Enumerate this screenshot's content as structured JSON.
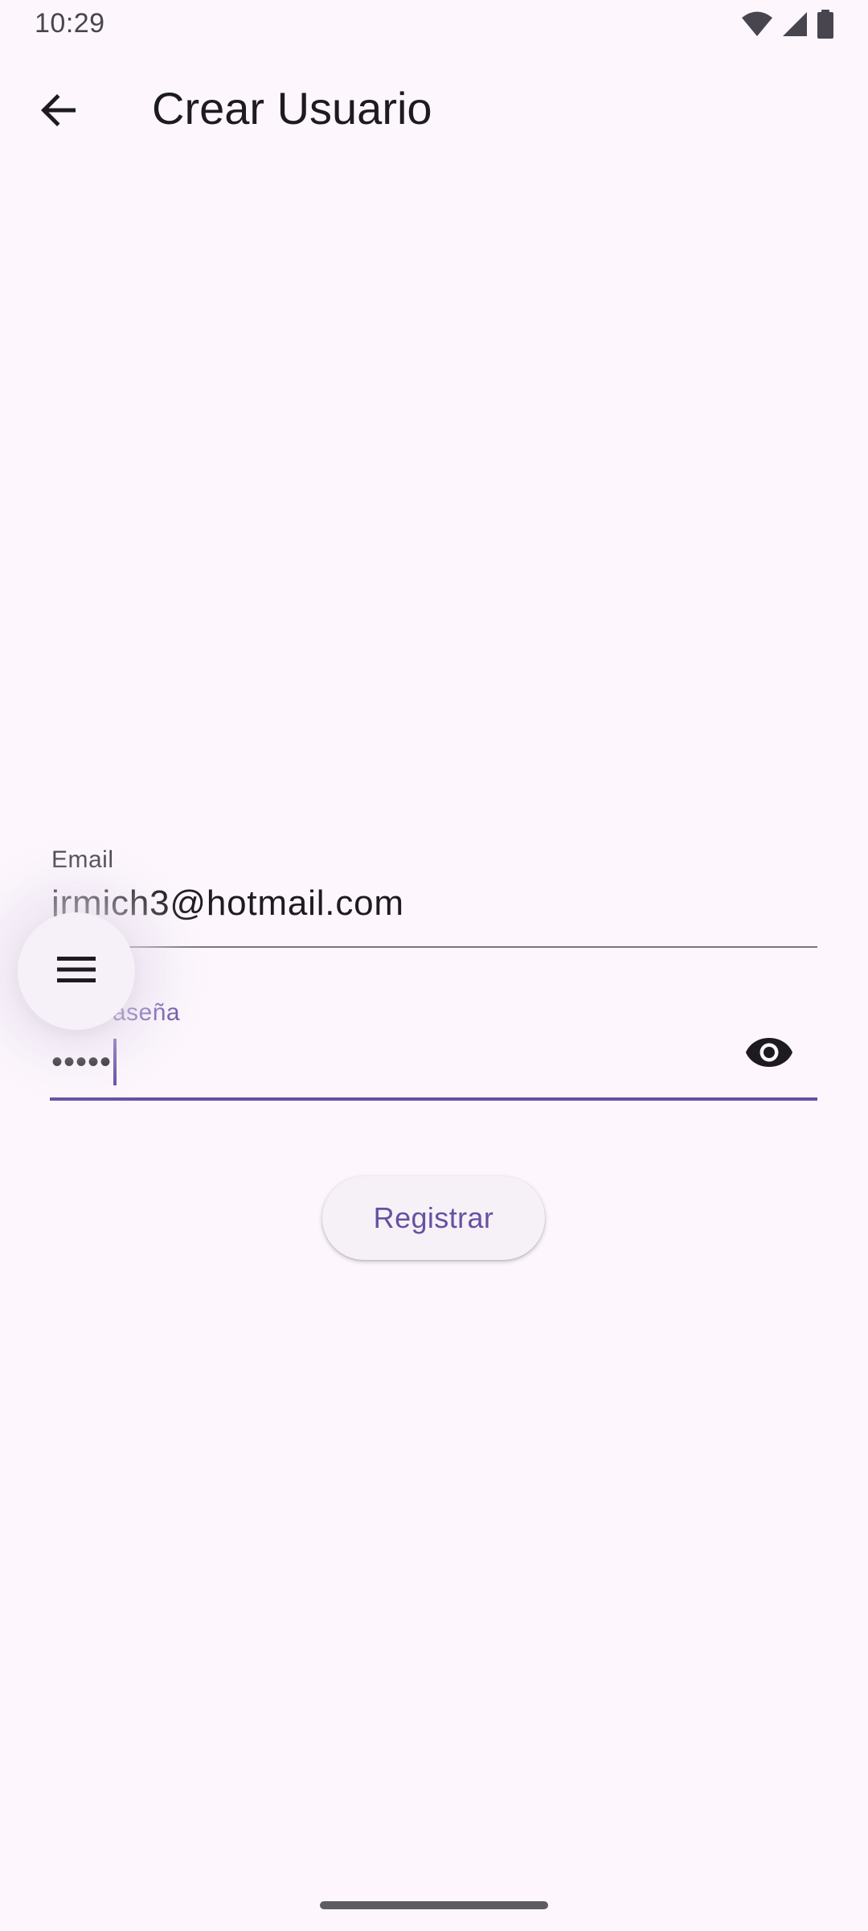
{
  "status_bar": {
    "time": "10:29",
    "icons": [
      "wifi-icon",
      "signal-icon",
      "battery-icon"
    ]
  },
  "app_bar": {
    "back_icon": "arrow-back-icon",
    "title": "Crear Usuario"
  },
  "form": {
    "email": {
      "label": "Email",
      "value": "jrmich3@hotmail.com"
    },
    "password": {
      "label": "Contraseña",
      "value": "•••••",
      "visibility_icon": "eye-icon"
    },
    "submit_label": "Registrar"
  },
  "menu_fab": {
    "icon": "menu-icon"
  },
  "colors": {
    "background": "#fdf7fd",
    "primary": "#6750a4",
    "on_surface": "#1d1b20",
    "on_surface_variant": "#49454f"
  }
}
